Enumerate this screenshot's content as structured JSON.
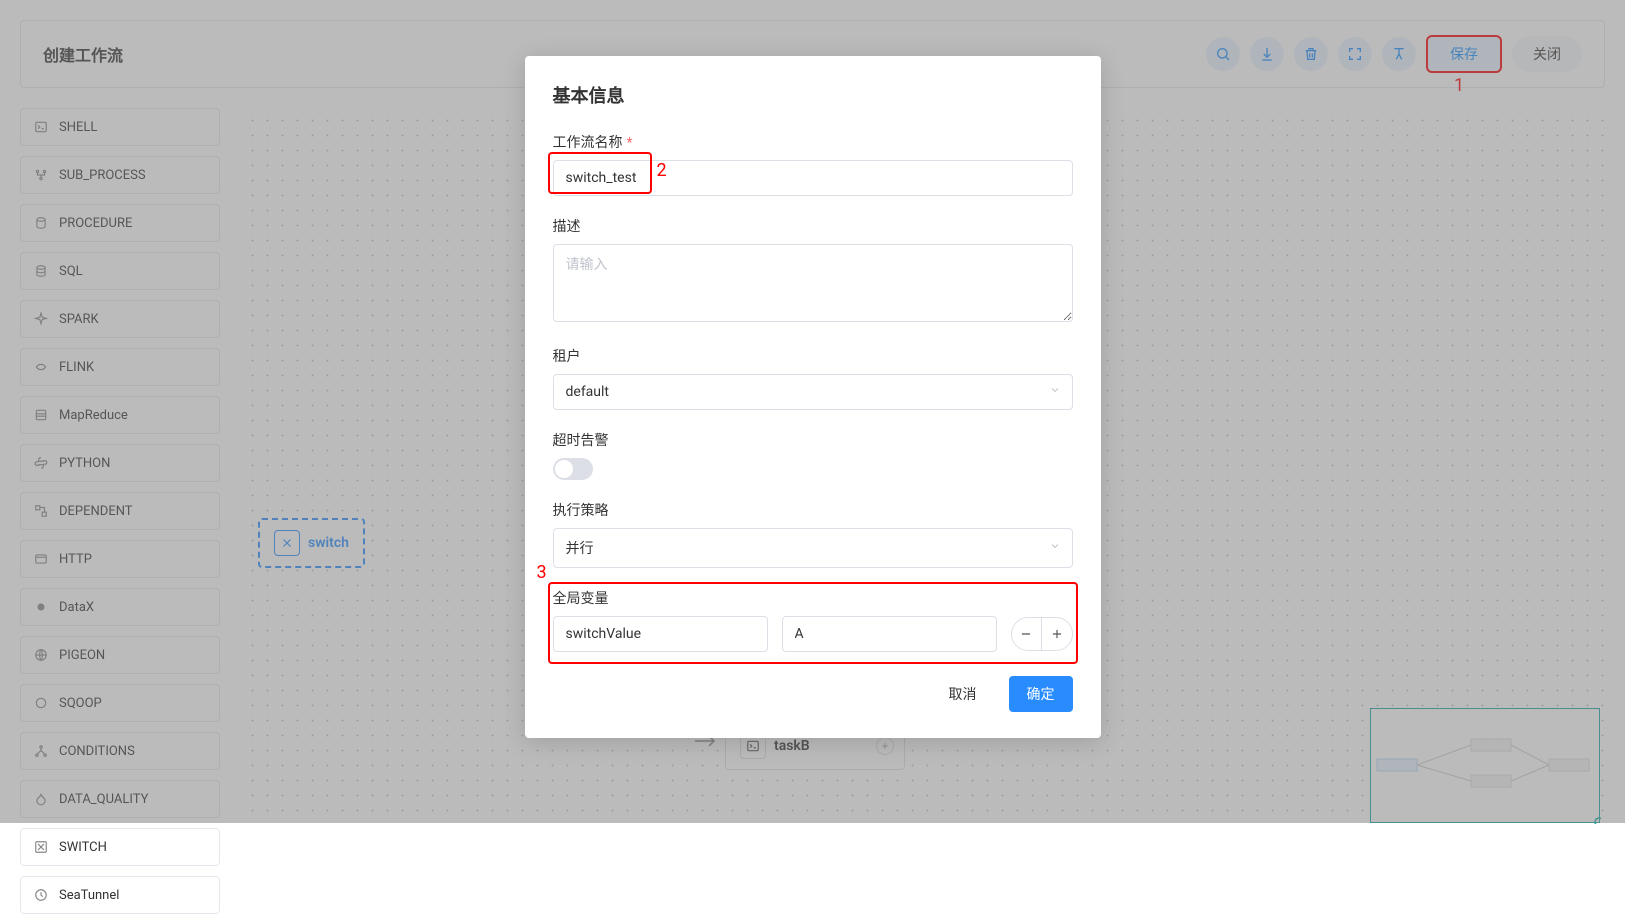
{
  "page": {
    "title": "创建工作流",
    "save_label": "保存",
    "close_label": "关闭"
  },
  "annotations": {
    "one": "1",
    "two": "2",
    "three": "3"
  },
  "sidebar": {
    "items": [
      {
        "label": "SHELL"
      },
      {
        "label": "SUB_PROCESS"
      },
      {
        "label": "PROCEDURE"
      },
      {
        "label": "SQL"
      },
      {
        "label": "SPARK"
      },
      {
        "label": "FLINK"
      },
      {
        "label": "MapReduce"
      },
      {
        "label": "PYTHON"
      },
      {
        "label": "DEPENDENT"
      },
      {
        "label": "HTTP"
      },
      {
        "label": "DataX"
      },
      {
        "label": "PIGEON"
      },
      {
        "label": "SQOOP"
      },
      {
        "label": "CONDITIONS"
      },
      {
        "label": "DATA_QUALITY"
      },
      {
        "label": "SWITCH"
      },
      {
        "label": "SeaTunnel"
      }
    ]
  },
  "canvas": {
    "switch_node": "switch",
    "taskb_node": "taskB"
  },
  "modal": {
    "title": "基本信息",
    "name_label": "工作流名称",
    "name_value": "switch_test",
    "desc_label": "描述",
    "desc_placeholder": "请输入",
    "tenant_label": "租户",
    "tenant_value": "default",
    "timeout_label": "超时告警",
    "strategy_label": "执行策略",
    "strategy_value": "并行",
    "globals_label": "全局变量",
    "globals": {
      "key": "switchValue",
      "value": "A"
    },
    "cancel": "取消",
    "ok": "确定"
  }
}
